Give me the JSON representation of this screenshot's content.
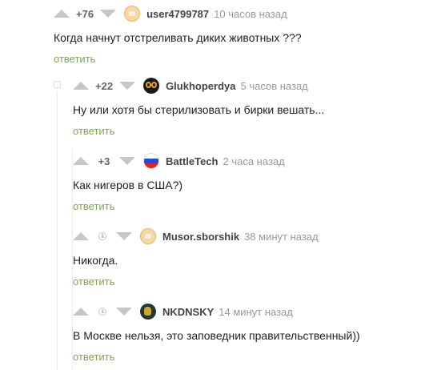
{
  "comments": [
    {
      "rating": "+76",
      "avatar_icon": "avatar-default-icon",
      "user": "user4799787",
      "time": "10 часов назад",
      "text": "Когда начнут отстреливать диких животных ???",
      "reply": "ответить"
    },
    {
      "rating": "+22",
      "avatar_icon": "avatar-glasses-icon",
      "user": "Glukhoperdya",
      "time": "5 часов назад",
      "text": "Ну или хотя бы стерилизовать и бирки вешать...",
      "reply": "ответить"
    },
    {
      "rating": "+3",
      "avatar_icon": "russian-flag-icon",
      "user": "BattleTech",
      "time": "2 часа назад",
      "text": "Как нигеров в США?)",
      "reply": "ответить"
    },
    {
      "rating": "",
      "avatar_icon": "avatar-default-icon",
      "user": "Musor.sborshik",
      "time": "38 минут назад",
      "text": "Никогда.",
      "reply": "ответить"
    },
    {
      "rating": "",
      "avatar_icon": "avatar-tiger-icon",
      "user": "NKDNSKY",
      "time": "14 минут назад",
      "text": "В Москве нельзя, это заповедник правительственный))",
      "reply": "ответить"
    }
  ],
  "colors": {
    "reply_link": "#7ba84b",
    "vote_arrow": "#c6c6c6",
    "username": "#444444",
    "timestamp": "#999999"
  }
}
